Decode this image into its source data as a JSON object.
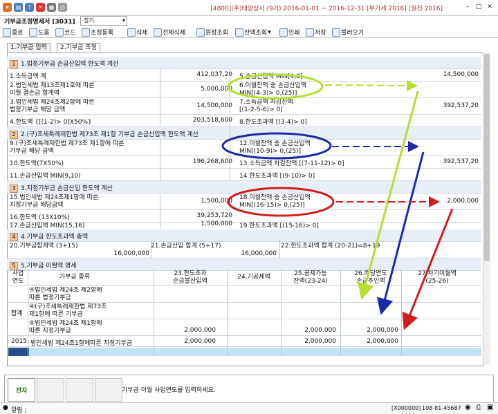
{
  "window": {
    "title": "기부금조정명세서 [3031]",
    "company": "[4800](주)태양상사 (9기) 2016-01-01 ~ 2016-12-31 [부가세 2016] [원천 2016]",
    "combo_value": "정기"
  },
  "toolbar": [
    {
      "label": "종료",
      "icon": "close-icon"
    },
    {
      "label": "도움",
      "icon": "help-icon"
    },
    {
      "label": "코드",
      "icon": "code-icon"
    },
    {
      "label": "조정등록",
      "icon": "register-icon"
    },
    {
      "label": "삭제",
      "icon": "delete-icon"
    },
    {
      "label": "전체삭제",
      "icon": "delete-all-icon"
    },
    {
      "label": "원장조회",
      "icon": "ledger-icon"
    },
    {
      "label": "잔액조회",
      "icon": "balance-icon"
    },
    {
      "label": "인쇄",
      "icon": "print-icon"
    },
    {
      "label": "저장",
      "icon": "save-icon"
    },
    {
      "label": "불러오기",
      "icon": "load-icon"
    }
  ],
  "tabs": [
    "1.기부금 입력",
    "2.기부금 조정"
  ],
  "sections": {
    "s1": {
      "num": "1",
      "title": "1.법정기부금 손금산입액 한도액 계산"
    },
    "s2": {
      "num": "2",
      "title": "2.(구)조세특례제한법 제73조 제1항 기부금 손금산입액 한도액 계산"
    },
    "s3": {
      "num": "3",
      "title": "3.지정기부금 손금산입 한도액 계산"
    },
    "s4": {
      "num": "4",
      "title": "4.기부금 한도초과액 총액"
    },
    "s5": {
      "num": "5",
      "title": "5.기부금 이월액 명세"
    }
  },
  "s1_rows": [
    {
      "l": "1.소득금액 계",
      "lv": "412,037,20",
      "r": "5.손금산입액 MIN[4,3]",
      "rv": "14,500,000"
    },
    {
      "l": "2.법인세법 제13조제1호에 따른\n이월 결손금 합계액",
      "lv": "5,000,000",
      "r": "6.이월잔액 중 손금산입액\nMIN[(4-3)> 0,(25)]",
      "rv": ""
    },
    {
      "l": "3.법인세법 제24조제2항에 따른\n법정기부금 해당 금액",
      "lv": "14,500,000",
      "r": "7.소득금액 차감잔액\n[(1-2-5-6)> 0]",
      "rv": "392,537,20"
    },
    {
      "l": "4.한도액 {[(1-2)> 0]X50%}",
      "lv": "203,518,600",
      "r": "8.한도초과액 [(3-4)> 0]",
      "rv": ""
    }
  ],
  "s2_rows": [
    {
      "l": "9.(구)조세특례제한법 제73조 제1항에 따른\n기부금 해당 금액",
      "lv": "",
      "r": "12.이월잔액 중 손금산입액\nMIN[(10-9)> 0,(25)]",
      "rv": ""
    },
    {
      "l": "10.한도액(7X50%)",
      "lv": "196,268,600",
      "r": "13.소득금액 차감잔액 [(7-11-12)> 0]",
      "rv": "392,537,20"
    },
    {
      "l": "11.손금산입액 MIN(9,10)",
      "lv": "",
      "r": "14.한도초과액 [(9-10)> 0]",
      "rv": ""
    }
  ],
  "s3_rows": [
    {
      "l": "15.법인세법 제24조제1항에 따른\n지정기부금 해당금액",
      "lv": "1,500,000",
      "r": "18.이월잔액 중 손금산입액\nMIN[(16-15)> 0,(25)]",
      "rv": "2,000,000"
    },
    {
      "l": "16.한도액 (13X10%)",
      "lv": "39,253,720",
      "r": "",
      "rv": ""
    },
    {
      "l": "17.손금산입액 MIN(15,16)",
      "lv": "1,500,000",
      "r": "19.한도초과액 [(15-16)> 0]",
      "rv": ""
    }
  ],
  "s4": {
    "h20": "20.기부금합계액 (3+15)",
    "v20": "16,000,000",
    "h21": "21.손금산입 합계 (5+17)",
    "v21": "16,000,000",
    "h22": "22.한도초과액 합계 (20-21)=8+19",
    "v22": ""
  },
  "s5": {
    "headers": [
      "사업\n연도",
      "기부금 종류",
      "23.한도초과\n손금불산입액",
      "24.기공제액",
      "25.공제가능\n잔액(23-24)",
      "26.해당연도\n손금추인액",
      "27.차기이월액\n(25-26)"
    ],
    "group_label": "합계",
    "rows": [
      {
        "kind": "④법인세법 제24조 제2항에\n따른 법정기부금",
        "c23": "",
        "c24": "",
        "c25": "",
        "c26": "",
        "c27": ""
      },
      {
        "kind": "④(구)조세특례제한법 제73조\n제1항에 따른 기부금",
        "c23": "",
        "c24": "",
        "c25": "",
        "c26": "",
        "c27": ""
      },
      {
        "kind": "④법인세법 제24조 제1항에\n따른 지정기부금",
        "c23": "2,000,000",
        "c24": "",
        "c25": "2,000,000",
        "c26": "2,000,000",
        "c27": ""
      }
    ],
    "detail": {
      "year": "2015",
      "kind": "법인세법 제24조1항에따른 지정기부금",
      "c23": "2,000,000",
      "c25": "2,000,000",
      "c26": "2,000,000"
    }
  },
  "bottom": {
    "jeonja": "전자",
    "hint": "기부금 이월 사업연도를 입력하세요."
  },
  "status": {
    "alert": "알림 :",
    "code": "[X000000]",
    "bizno": "108-81-45687"
  },
  "colors": {
    "green": "#b5df2e",
    "blue": "#1c2aa8",
    "red": "#d01c1c"
  }
}
